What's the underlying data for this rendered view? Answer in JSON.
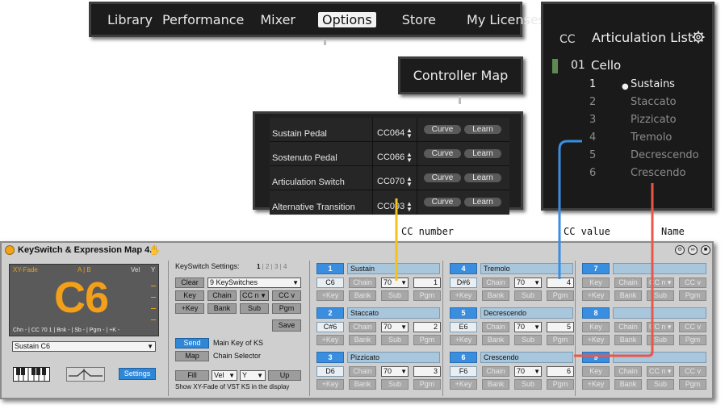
{
  "nav": {
    "items": [
      "Library",
      "Performance",
      "Mixer",
      "Options",
      "Store",
      "My Licenses"
    ],
    "active": "Options"
  },
  "controller_map_button": "Controller Map",
  "cc_table": {
    "rows": [
      {
        "name": "Sustain Pedal",
        "cc": "CC064"
      },
      {
        "name": "Sostenuto Pedal",
        "cc": "CC066"
      },
      {
        "name": "Articulation Switch",
        "cc": "CC070"
      },
      {
        "name": "Alternative Transition",
        "cc": "CC093"
      }
    ],
    "curve_label": "Curve",
    "learn_label": "Learn"
  },
  "articulation": {
    "cc_header": "CC",
    "title": "Articulation List",
    "group_num": "01",
    "group_name": "Cello",
    "items": [
      {
        "num": "1",
        "name": "Sustains",
        "selected": true
      },
      {
        "num": "2",
        "name": "Staccato",
        "selected": false
      },
      {
        "num": "3",
        "name": "Pizzicato",
        "selected": false
      },
      {
        "num": "4",
        "name": "Tremolo",
        "selected": false
      },
      {
        "num": "5",
        "name": "Decrescendo",
        "selected": false
      },
      {
        "num": "6",
        "name": "Crescendo",
        "selected": false
      }
    ]
  },
  "callouts": {
    "cc_number": "CC number",
    "cc_value": "CC value",
    "name": "Name"
  },
  "colors": {
    "accent_orange": "#f29f1a",
    "slot_blue": "#3a8ee0",
    "line_yellow": "#f2c31a",
    "line_blue": "#3a8ee0",
    "line_red": "#e8574a"
  },
  "plugin": {
    "title": "KeySwitch & Expression Map 4.0",
    "display": {
      "xy_label": "XY-Fade",
      "ab_label": "A | B",
      "vel_label": "Vel",
      "y_label": "Y",
      "note": "C6",
      "status": "Chn - | CC 70 1 | Bnk - | Sb - | Pgm - | +K -"
    },
    "preset": "Sustain C6",
    "settings_button": "Settings",
    "ks_settings_label": "KeySwitch Settings:",
    "pages": [
      "1",
      "2",
      "3",
      "4"
    ],
    "clear": "Clear",
    "ks_count": "9 KeySwitches",
    "key": "Key",
    "chain": "Chain",
    "cc_n": "CC n",
    "cc_v": "CC v",
    "plus_key": "+Key",
    "bank": "Bank",
    "sub": "Sub",
    "pgm": "Pgm",
    "save": "Save",
    "send": "Send",
    "send_desc": "Main Key of KS",
    "map": "Map",
    "map_desc": "Chain Selector",
    "fill": "Fill",
    "vel": "Vel",
    "y": "Y",
    "up": "Up",
    "footer_note": "Show XY-Fade of VST KS in the display",
    "slots": [
      {
        "num": "1",
        "name": "Sustain",
        "note": "C6",
        "cc": "70",
        "val": "1"
      },
      {
        "num": "2",
        "name": "Staccato",
        "note": "C#6",
        "cc": "70",
        "val": "2"
      },
      {
        "num": "3",
        "name": "Pizzicato",
        "note": "D6",
        "cc": "70",
        "val": "3"
      },
      {
        "num": "4",
        "name": "Tremolo",
        "note": "D#6",
        "cc": "70",
        "val": "4"
      },
      {
        "num": "5",
        "name": "Decrescendo",
        "note": "E6",
        "cc": "70",
        "val": "5"
      },
      {
        "num": "6",
        "name": "Crescendo",
        "note": "F6",
        "cc": "70",
        "val": "6"
      },
      {
        "num": "7",
        "name": "",
        "note": "Key",
        "cc": "CC n",
        "val": "CC v"
      },
      {
        "num": "8",
        "name": "",
        "note": "Key",
        "cc": "CC n",
        "val": "CC v"
      },
      {
        "num": "9",
        "name": "",
        "note": "Key",
        "cc": "CC n",
        "val": "CC v"
      }
    ]
  }
}
